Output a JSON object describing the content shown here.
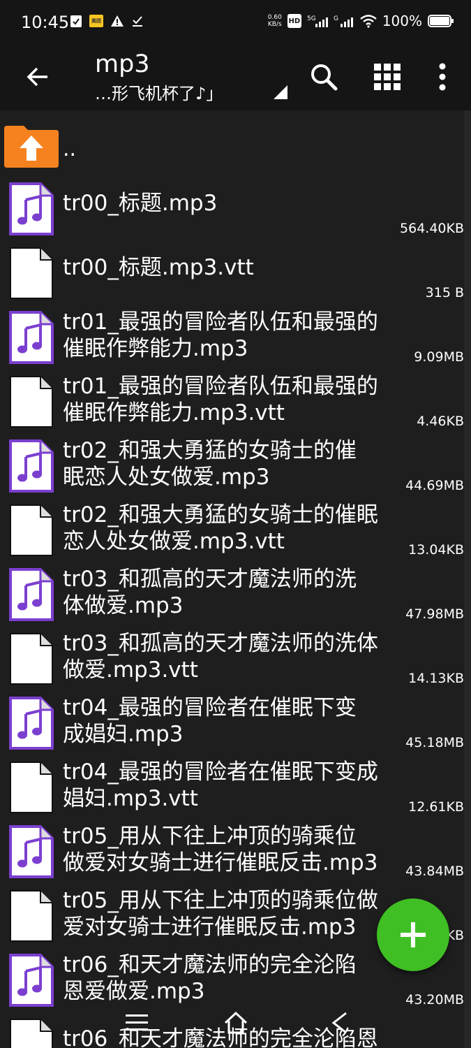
{
  "status_bar": {
    "time": "10:45",
    "network_speed_value": "0.60",
    "network_speed_unit": "KB/s",
    "hd_label": "HD",
    "sim1_label": "5G",
    "sim2_label": "G",
    "battery": "100%",
    "meituan_label": "美团"
  },
  "app_bar": {
    "title": "mp3",
    "subtitle": "…形飞机杯了♪」"
  },
  "parent": {
    "label": ".."
  },
  "files": [
    {
      "name": "tr00_标题.mp3",
      "size": "564.40KB",
      "type": "audio"
    },
    {
      "name": "tr00_标题.mp3.vtt",
      "size": "315 B",
      "type": "file"
    },
    {
      "name": "tr01_最强的冒险者队伍和最强的\n催眠作弊能力.mp3",
      "size": "9.09MB",
      "type": "audio"
    },
    {
      "name": "tr01_最强的冒险者队伍和最强的\n催眠作弊能力.mp3.vtt",
      "size": "4.46KB",
      "type": "file"
    },
    {
      "name": "tr02_和强大勇猛的女骑士的催\n眠恋人处女做爱.mp3",
      "size": "44.69MB",
      "type": "audio"
    },
    {
      "name": "tr02_和强大勇猛的女骑士的催眠\n恋人处女做爱.mp3.vtt",
      "size": "13.04KB",
      "type": "file"
    },
    {
      "name": "tr03_和孤高的天才魔法师的洗\n体做爱.mp3",
      "size": "47.98MB",
      "type": "audio"
    },
    {
      "name": "tr03_和孤高的天才魔法师的洗体\n做爱.mp3.vtt",
      "size": "14.13KB",
      "type": "file"
    },
    {
      "name": "tr04_最强的冒险者在催眠下变\n成娼妇.mp3",
      "size": "45.18MB",
      "type": "audio"
    },
    {
      "name": "tr04_最强的冒险者在催眠下变成\n娼妇.mp3.vtt",
      "size": "12.61KB",
      "type": "file"
    },
    {
      "name": "tr05_用从下往上冲顶的骑乘位\n做爱对女骑士进行催眠反击.mp3",
      "size": "43.84MB",
      "type": "audio"
    },
    {
      "name": "tr05_用从下往上冲顶的骑乘位做\n爱对女骑士进行催眠反击.mp3",
      "size": "KB",
      "type": "file"
    },
    {
      "name": "tr06_和天才魔法师的完全沦陷\n恩爱做爱.mp3",
      "size": "43.20MB",
      "type": "audio"
    },
    {
      "name": "tr06_和天才魔法师的完全沦陷恩",
      "size": "",
      "type": "file"
    }
  ],
  "colors": {
    "background": "#1e1e1e",
    "bar": "#151515",
    "audio_icon_border": "#7b3fd0",
    "audio_note": "#7b3fd0",
    "folder": "#f5821f",
    "fab": "#3fbf24"
  },
  "icons": {
    "back": "arrow-left-icon",
    "search": "search-icon",
    "grid": "grid-view-icon",
    "more": "more-vertical-icon",
    "add": "plus-icon",
    "parent_folder": "folder-up-icon"
  }
}
